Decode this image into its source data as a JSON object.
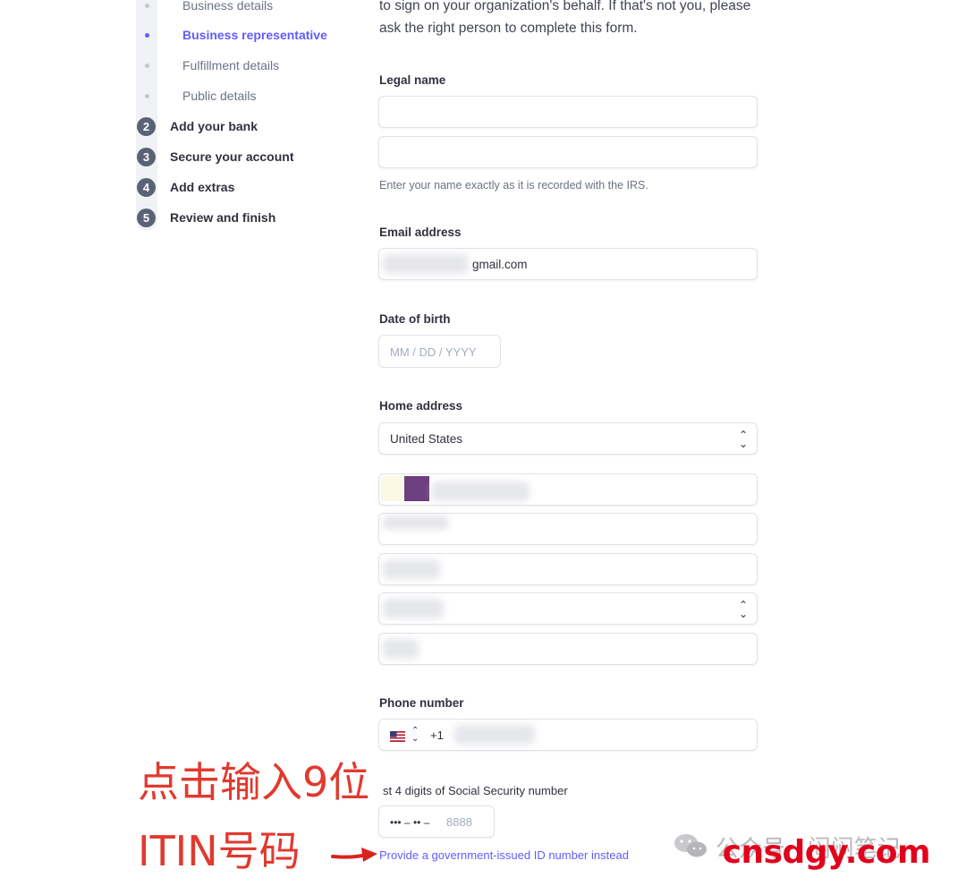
{
  "sidebar": {
    "sub_items": [
      {
        "label": "Business details",
        "active": false
      },
      {
        "label": "Business representative",
        "active": true
      },
      {
        "label": "Fulfillment details",
        "active": false
      },
      {
        "label": "Public details",
        "active": false
      }
    ],
    "steps": [
      {
        "num": "2",
        "label": "Add your bank"
      },
      {
        "num": "3",
        "label": "Secure your account"
      },
      {
        "num": "4",
        "label": "Add extras"
      },
      {
        "num": "5",
        "label": "Review and finish"
      }
    ]
  },
  "form": {
    "intro": "to sign on your organization's behalf. If that's not you, please ask the right person to complete this form.",
    "legal_name": {
      "label": "Legal name",
      "help": "Enter your name exactly as it is recorded with the IRS."
    },
    "email": {
      "label": "Email address",
      "value": "gmail.com"
    },
    "dob": {
      "label": "Date of birth",
      "placeholder": "MM / DD / YYYY"
    },
    "home_address": {
      "label": "Home address",
      "country": "United States"
    },
    "phone": {
      "label": "Phone number",
      "code": "+1"
    },
    "ssn": {
      "label": "st 4 digits of Social Security number",
      "mask": "••• – •• –",
      "placeholder": "8888"
    },
    "id_link": "Provide a government-issued ID number instead"
  },
  "annotations": {
    "line1": "点击输入9位",
    "line2": "ITIN号码",
    "watermark_cn": "公众号 · 闷闷笔记",
    "brand": "cnsdgy.com"
  },
  "colors": {
    "accent": "#635bff",
    "annotation": "#e03a2f",
    "brand": "#e3001b"
  }
}
